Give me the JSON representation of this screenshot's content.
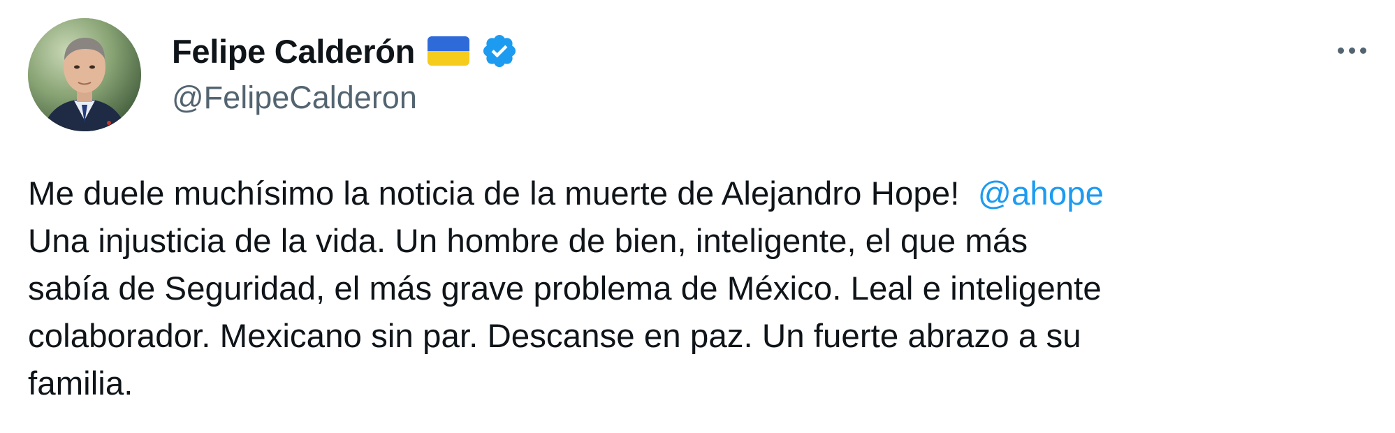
{
  "author": {
    "display_name": "Felipe Calderón",
    "handle": "@FelipeCalderon",
    "flag_icon": "ukraine-flag-icon",
    "verified_icon": "verified-badge-icon",
    "colors": {
      "flag_top": "#2f6bd8",
      "flag_bottom": "#f5cb1c",
      "verified": "#1d9bf0"
    }
  },
  "actions": {
    "more_icon": "more-options-icon"
  },
  "tweet": {
    "line1_text": "Me duele muchísimo la noticia de la muerte de Alejandro Hope!",
    "line1_mention": "@ahope",
    "line2": "Una injusticia de la vida. Un hombre de bien, inteligente, el que más",
    "line3": "sabía de Seguridad, el más grave problema de México. Leal e inteligente",
    "line4": "colaborador. Mexicano sin par. Descanse en paz. Un fuerte abrazo a su",
    "line5": "familia.",
    "mention_color": "#1d9bf0"
  }
}
